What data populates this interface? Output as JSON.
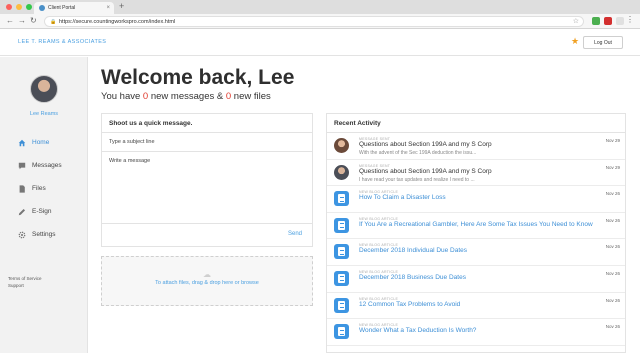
{
  "browser": {
    "tab_title": "Client Portal",
    "tab_close": "×",
    "new_tab": "+",
    "url": "https://secure.countingworkspro.com/index.html",
    "back": "←",
    "forward": "→",
    "reload": "↻",
    "lock": "🔒",
    "star": "☆",
    "menu": "⋮",
    "window_colors": [
      "#fc605c",
      "#fdbc40",
      "#34c84a"
    ]
  },
  "header": {
    "firm_name": "LEE T. REAMS & ASSOCIATES",
    "logout": "Log Out",
    "favorite_icon": "★"
  },
  "sidebar": {
    "user_name": "Lee Reams",
    "items": [
      {
        "label": "Home",
        "icon": "home-icon",
        "active": true
      },
      {
        "label": "Messages",
        "icon": "chat-icon",
        "active": false
      },
      {
        "label": "Files",
        "icon": "file-icon",
        "active": false
      },
      {
        "label": "E-Sign",
        "icon": "pen-icon",
        "active": false
      },
      {
        "label": "Settings",
        "icon": "gear-icon",
        "active": false
      }
    ],
    "terms": "Terms of Service",
    "support": "Support"
  },
  "main": {
    "welcome": "Welcome back, Lee",
    "summary_prefix": "You have ",
    "new_messages": "0",
    "summary_middle": " new messages & ",
    "new_files": "0",
    "summary_suffix": " new files"
  },
  "compose": {
    "title": "Shoot us a quick message.",
    "subject_placeholder": "Type a subject line",
    "message_placeholder": "Write a message",
    "send": "Send"
  },
  "dropzone": {
    "icon": "upload-cloud-icon",
    "text": "To attach files, drag & drop here or browse"
  },
  "activity": {
    "title": "Recent Activity",
    "items": [
      {
        "kind": "person",
        "label": "MESSAGE SENT",
        "title": "Questions about Section 199A and my S Corp",
        "snippet": "With the advent of the Sec 199A deduction the issu...",
        "date": "Nov 29"
      },
      {
        "kind": "person",
        "label": "MESSAGE SENT",
        "title": "Questions about Section 199A and my S Corp",
        "snippet": "I have read your tax updates and realize I need to ...",
        "date": "Nov 29"
      },
      {
        "kind": "doc",
        "label": "NEW BLOG ARTICLE",
        "title": "How To Claim a Disaster Loss",
        "snippet": "",
        "date": "Nov 26"
      },
      {
        "kind": "doc",
        "label": "NEW BLOG ARTICLE",
        "title": "If You Are a Recreational Gambler, Here Are Some Tax Issues You Need to Know",
        "snippet": "",
        "date": "Nov 26"
      },
      {
        "kind": "doc",
        "label": "NEW BLOG ARTICLE",
        "title": "December 2018 Individual Due Dates",
        "snippet": "",
        "date": "Nov 26"
      },
      {
        "kind": "doc",
        "label": "NEW BLOG ARTICLE",
        "title": "December 2018 Business Due Dates",
        "snippet": "",
        "date": "Nov 26"
      },
      {
        "kind": "doc",
        "label": "NEW BLOG ARTICLE",
        "title": "12 Common Tax Problems to Avoid",
        "snippet": "",
        "date": "Nov 26"
      },
      {
        "kind": "doc",
        "label": "NEW BLOG ARTICLE",
        "title": "Wonder What a Tax Deduction Is Worth?",
        "snippet": "",
        "date": "Nov 26"
      }
    ]
  }
}
